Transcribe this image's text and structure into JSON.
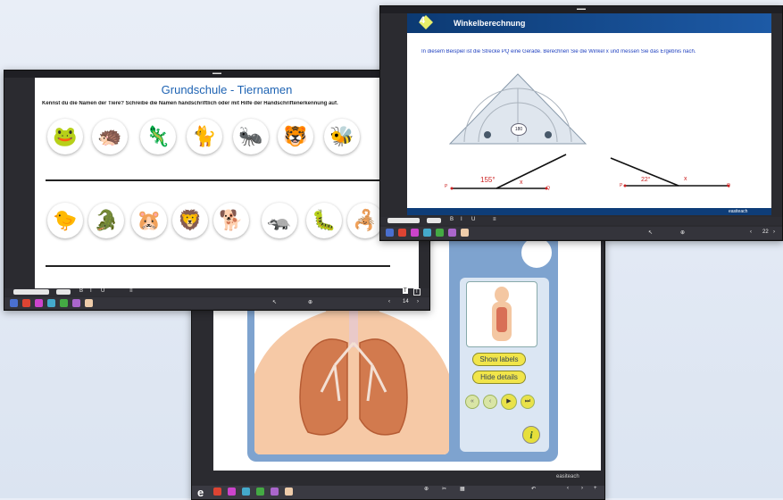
{
  "colors": {
    "frame_dark": "#2b2b30",
    "title_blue": "#1e63b3",
    "header_navy": "#0e3d78",
    "text_red": "#cc2222",
    "panel_blue": "#6e98c9",
    "button_yellow": "#f1e54a"
  },
  "left_window": {
    "heading": "Grundschule - Tiernamen",
    "instruction": "Kennst du die Namen der Tiere? Schreibe die Namen handschriftlich oder mit Hilfe der Handschriftenerkennung auf.",
    "animals_row1": [
      "frog",
      "hedgehog",
      "lizard",
      "cat",
      "ant",
      "tiger",
      "bee"
    ],
    "animals_row2": [
      "chick",
      "crocodile",
      "hamster",
      "lion",
      "dog",
      "badger",
      "caterpillar",
      "scorpion"
    ],
    "animal_glyphs_row1": [
      "🐸",
      "🦔",
      "🦎",
      "🐈",
      "🐜",
      "🐯",
      "🐝"
    ],
    "animal_glyphs_row2": [
      "🐤",
      "🐊",
      "🐹",
      "🦁",
      "🐕",
      "🦡",
      "🐛",
      "🦂"
    ],
    "page_number": "14"
  },
  "right_window": {
    "header_title": "Winkelberechnung",
    "header_logo": "4",
    "instruction": "In diesem Beispiel ist die Strecke PQ eine Gerade. Berechnen Sie die Winkel x und messen Sie das Ergebnis nach.",
    "protractor_center_label": "180",
    "angle1_value": "155°",
    "angle1_unknown": "x",
    "angle2_value": "22°",
    "angle2_unknown": "x",
    "point_p": "P",
    "point_q": "Q",
    "brand": "easiteach",
    "page_number": "22"
  },
  "center_window": {
    "show_labels_button": "Show labels",
    "hide_details_button": "Hide details",
    "info_icon": "i",
    "brand": "easiteach",
    "taskbar_logo": "e"
  }
}
